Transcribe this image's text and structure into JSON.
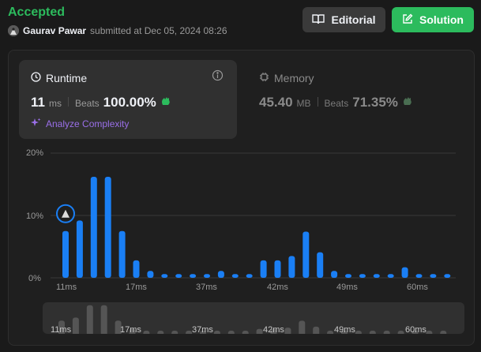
{
  "header": {
    "status": "Accepted",
    "author_name": "Gaurav Pawar",
    "submitted_text": "submitted at Dec 05, 2024 08:26",
    "editorial_label": "Editorial",
    "solution_label": "Solution"
  },
  "runtime": {
    "title": "Runtime",
    "value": "11",
    "unit": "ms",
    "beats_label": "Beats",
    "beats_value": "100.00%",
    "analyze_label": "Analyze Complexity"
  },
  "memory": {
    "title": "Memory",
    "value": "45.40",
    "unit": "MB",
    "beats_label": "Beats",
    "beats_value": "71.35%"
  },
  "colors": {
    "accent_green": "#2cbb5d",
    "bar_blue": "#1a7ff5",
    "purple": "#9a6fe8"
  },
  "chart_data": {
    "type": "bar",
    "y_ticks": [
      "20%",
      "10%",
      "0%"
    ],
    "ylim": [
      0,
      20
    ],
    "x_tick_labels": [
      "11ms",
      "17ms",
      "37ms",
      "42ms",
      "49ms",
      "60ms"
    ],
    "values": [
      7.5,
      9.2,
      16.2,
      16.2,
      7.5,
      2.8,
      1.1,
      0.6,
      0.6,
      0.6,
      0.6,
      1.1,
      0.6,
      0.6,
      2.8,
      2.8,
      3.5,
      7.4,
      4.1,
      1.1,
      0.6,
      0.6,
      0.6,
      0.6,
      1.7,
      0.6,
      0.6,
      0.6
    ],
    "highlight_index": 0
  }
}
